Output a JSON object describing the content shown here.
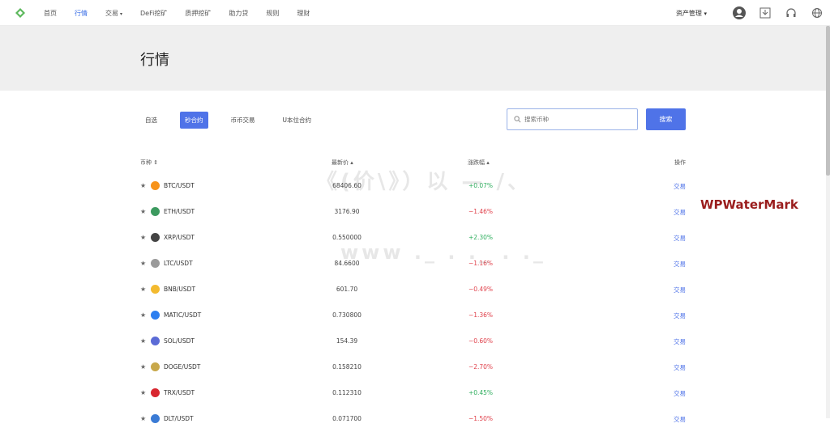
{
  "nav": {
    "items": [
      "首页",
      "行情",
      "交易",
      "DeFi挖矿",
      "质押挖矿",
      "助力贷",
      "规则",
      "理财"
    ],
    "active_index": 1,
    "dropdown_index": 2
  },
  "header": {
    "asset_menu": "资产管理"
  },
  "banner": {
    "title": "行情"
  },
  "tabs": [
    "自选",
    "秒合约",
    "币币交易",
    "U本位合约"
  ],
  "active_tab": 1,
  "search": {
    "placeholder": "搜索币种",
    "button": "搜索"
  },
  "table": {
    "headers": {
      "coin": "币种 ⇕",
      "price": "最新价 ▴",
      "change": "涨跌幅 ▴",
      "action": "操作"
    },
    "rows": [
      {
        "pair": "BTC/USDT",
        "price": "68406.60",
        "change": "+0.07%",
        "dir": "up",
        "action": "交易",
        "color": "#f7931a"
      },
      {
        "pair": "ETH/USDT",
        "price": "3176.90",
        "change": "−1.46%",
        "dir": "down",
        "action": "交易",
        "color": "#3c9a5f"
      },
      {
        "pair": "XRP/USDT",
        "price": "0.550000",
        "change": "+2.30%",
        "dir": "up",
        "action": "交易",
        "color": "#444444"
      },
      {
        "pair": "LTC/USDT",
        "price": "84.6600",
        "change": "−1.16%",
        "dir": "down",
        "action": "交易",
        "color": "#9a9a9a"
      },
      {
        "pair": "BNB/USDT",
        "price": "601.70",
        "change": "−0.49%",
        "dir": "down",
        "action": "交易",
        "color": "#f3ba2f"
      },
      {
        "pair": "MATIC/USDT",
        "price": "0.730800",
        "change": "−1.36%",
        "dir": "down",
        "action": "交易",
        "color": "#2d7ff0"
      },
      {
        "pair": "SOL/USDT",
        "price": "154.39",
        "change": "−0.60%",
        "dir": "down",
        "action": "交易",
        "color": "#5b6bd6"
      },
      {
        "pair": "DOGE/USDT",
        "price": "0.158210",
        "change": "−2.70%",
        "dir": "down",
        "action": "交易",
        "color": "#c8a84b"
      },
      {
        "pair": "TRX/USDT",
        "price": "0.112310",
        "change": "+0.45%",
        "dir": "up",
        "action": "交易",
        "color": "#d8262f"
      },
      {
        "pair": "DLT/USDT",
        "price": "0.071700",
        "change": "−1.50%",
        "dir": "down",
        "action": "交易",
        "color": "#3a7bd5"
      }
    ]
  },
  "watermark": {
    "brand": "WPWaterMark"
  },
  "colors": {
    "accent": "#4f73e8",
    "up": "#2fae5e",
    "down": "#e0414b"
  }
}
